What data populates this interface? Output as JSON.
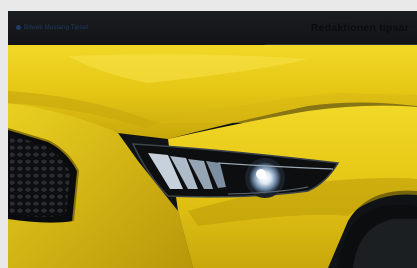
{
  "header": {
    "brand_text": "Bilweb Mustang Tipset",
    "section_label": "Redaktionen tipsar"
  },
  "colors": {
    "body_yellow": "#e6c914",
    "header_bg": "#15181b"
  },
  "icons": {
    "brand": "brand-dot-icon"
  }
}
